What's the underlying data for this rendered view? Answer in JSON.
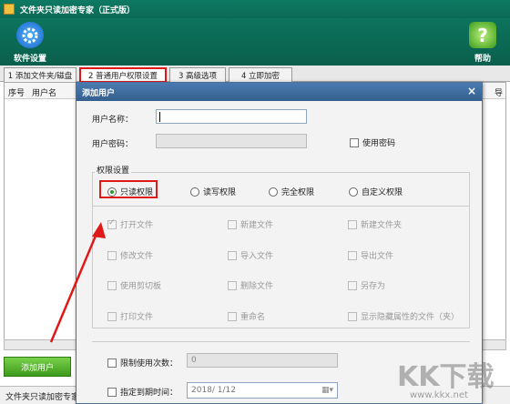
{
  "window": {
    "title": "文件夹只读加密专家（正式版）"
  },
  "toolbar": {
    "settings_label": "软件设置",
    "help_label": "帮助"
  },
  "tabs": [
    {
      "label": "1 添加文件夹/磁盘"
    },
    {
      "label": "2 普通用户权限设置"
    },
    {
      "label": "3 高级选项"
    },
    {
      "label": "4 立即加密"
    }
  ],
  "list": {
    "col_index": "序号",
    "col_user": "用户名",
    "col_right": "导"
  },
  "add_user_button": "添加用户",
  "status": "文件夹只读加密专家",
  "dialog": {
    "title": "添加用户",
    "close": "×",
    "username_label": "用户名称：",
    "username_value": "",
    "password_label": "用户密码：",
    "use_password_label": "使用密码",
    "perm_group_label": "权限设置",
    "modes": [
      {
        "label": "只读权限",
        "selected": true
      },
      {
        "label": "读写权限",
        "selected": false
      },
      {
        "label": "完全权限",
        "selected": false
      },
      {
        "label": "自定义权限",
        "selected": false
      }
    ],
    "perms": [
      [
        "打开文件",
        "新建文件",
        "新建文件夹"
      ],
      [
        "修改文件",
        "导入文件",
        "导出文件"
      ],
      [
        "使用剪切板",
        "删除文件",
        "另存为"
      ],
      [
        "打印文件",
        "重命名",
        "显示隐藏属性的文件（夹）"
      ]
    ],
    "limit_label": "限制使用次数：",
    "limit_value": "0",
    "expire_label": "指定到期时间：",
    "expire_value": "2018/ 1/12"
  },
  "watermark": {
    "text": "KK下载",
    "url": "www.kkx.net"
  }
}
